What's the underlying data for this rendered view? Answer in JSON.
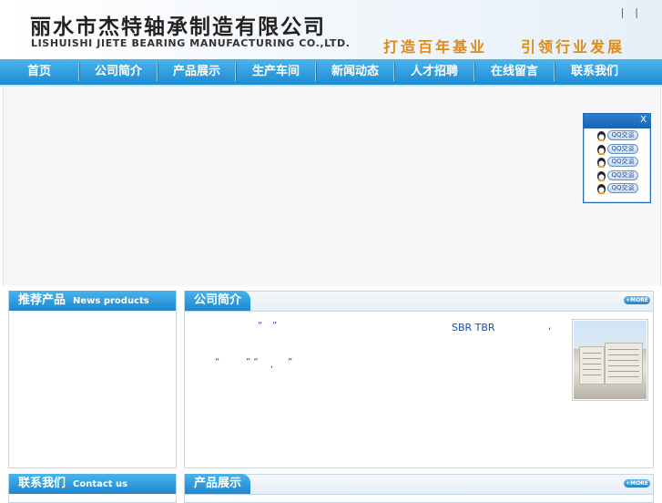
{
  "header": {
    "company_cn": "丽水市杰特轴承制造有限公司",
    "company_en": "LISHUISHI JIETE BEARING MANUFACTURING CO.,LTD.",
    "slogan_1": "打造百年基业",
    "slogan_2": "引领行业发展",
    "top_links": [
      "|",
      "|"
    ]
  },
  "nav": {
    "items": [
      "首页",
      "公司简介",
      "产品展示",
      "生产车间",
      "新闻动态",
      "人才招聘",
      "在线留言",
      "联系我们"
    ]
  },
  "qq_widget": {
    "close_label": "X",
    "buttons": [
      "QQ交谈",
      "QQ交谈",
      "QQ交谈",
      "QQ交谈",
      "QQ交谈"
    ]
  },
  "sidebar": {
    "products_title": "推荐产品",
    "products_title_en": "News products",
    "contact_title": "联系我们",
    "contact_title_en": "Contact us"
  },
  "main": {
    "about_title": "公司简介",
    "about_more": "+MORE",
    "about_text_1": "“",
    "about_text_2": "”",
    "about_text_3": "SBR TBR",
    "about_text_4": ",",
    "about_text_5": "“",
    "about_text_6": "” “",
    "about_text_7": ",",
    "about_text_8": "”",
    "products_title": "产品展示",
    "products_more": "+MORE"
  },
  "colors": {
    "nav_blue": "#1c8bd3",
    "slogan_orange": "#e08a16",
    "link_blue": "#1a4fb5"
  }
}
